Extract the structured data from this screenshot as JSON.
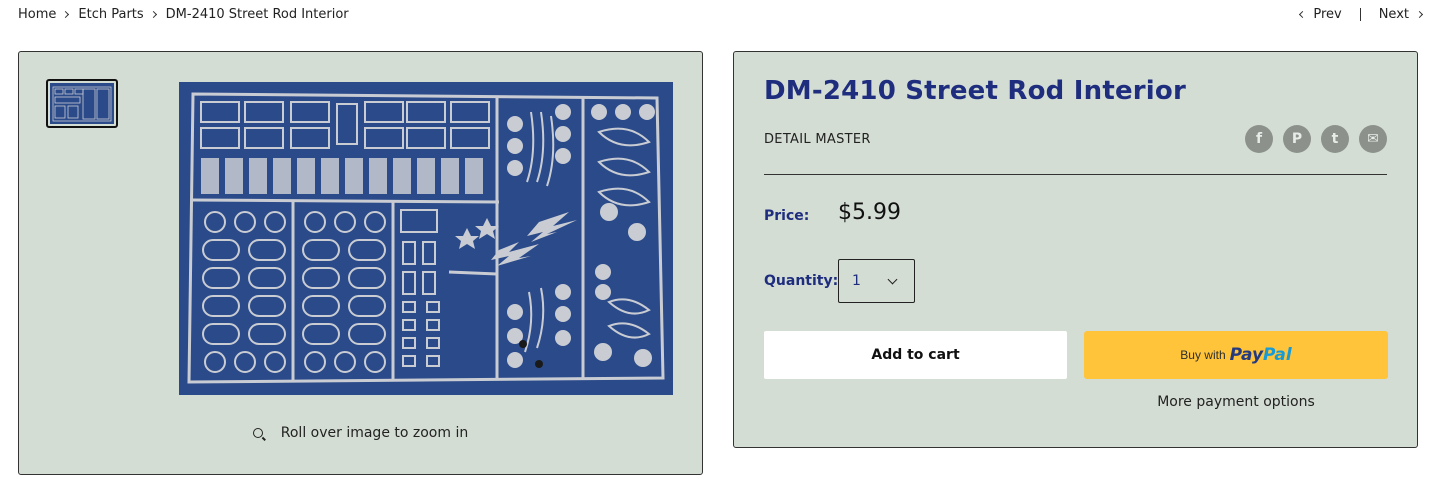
{
  "breadcrumb": {
    "items": [
      "Home",
      "Etch Parts",
      "DM-2410 Street Rod Interior"
    ]
  },
  "pager": {
    "prev": "Prev",
    "next": "Next"
  },
  "gallery": {
    "zoom_hint": "Roll over image to zoom in",
    "icons": {
      "zoom": "magnifier-icon"
    }
  },
  "product": {
    "title": "DM-2410 Street Rod Interior",
    "vendor": "DETAIL MASTER",
    "price_label": "Price:",
    "price": "$5.99",
    "quantity_label": "Quantity:",
    "quantity_value": "1",
    "add_to_cart": "Add to cart",
    "paypal_prefix": "Buy with",
    "paypal_brand_a": "Pay",
    "paypal_brand_b": "Pal",
    "more_payment": "More payment options"
  },
  "share": [
    {
      "name": "facebook-icon",
      "glyph": "f"
    },
    {
      "name": "pinterest-icon",
      "glyph": "P"
    },
    {
      "name": "twitter-icon",
      "glyph": "t"
    },
    {
      "name": "email-icon",
      "glyph": "✉"
    }
  ],
  "colors": {
    "panel_bg": "#d4ddd4",
    "accent": "#1e2d7d",
    "paypal_bg": "#ffc439",
    "photo_bg": "#2b4a8a"
  }
}
